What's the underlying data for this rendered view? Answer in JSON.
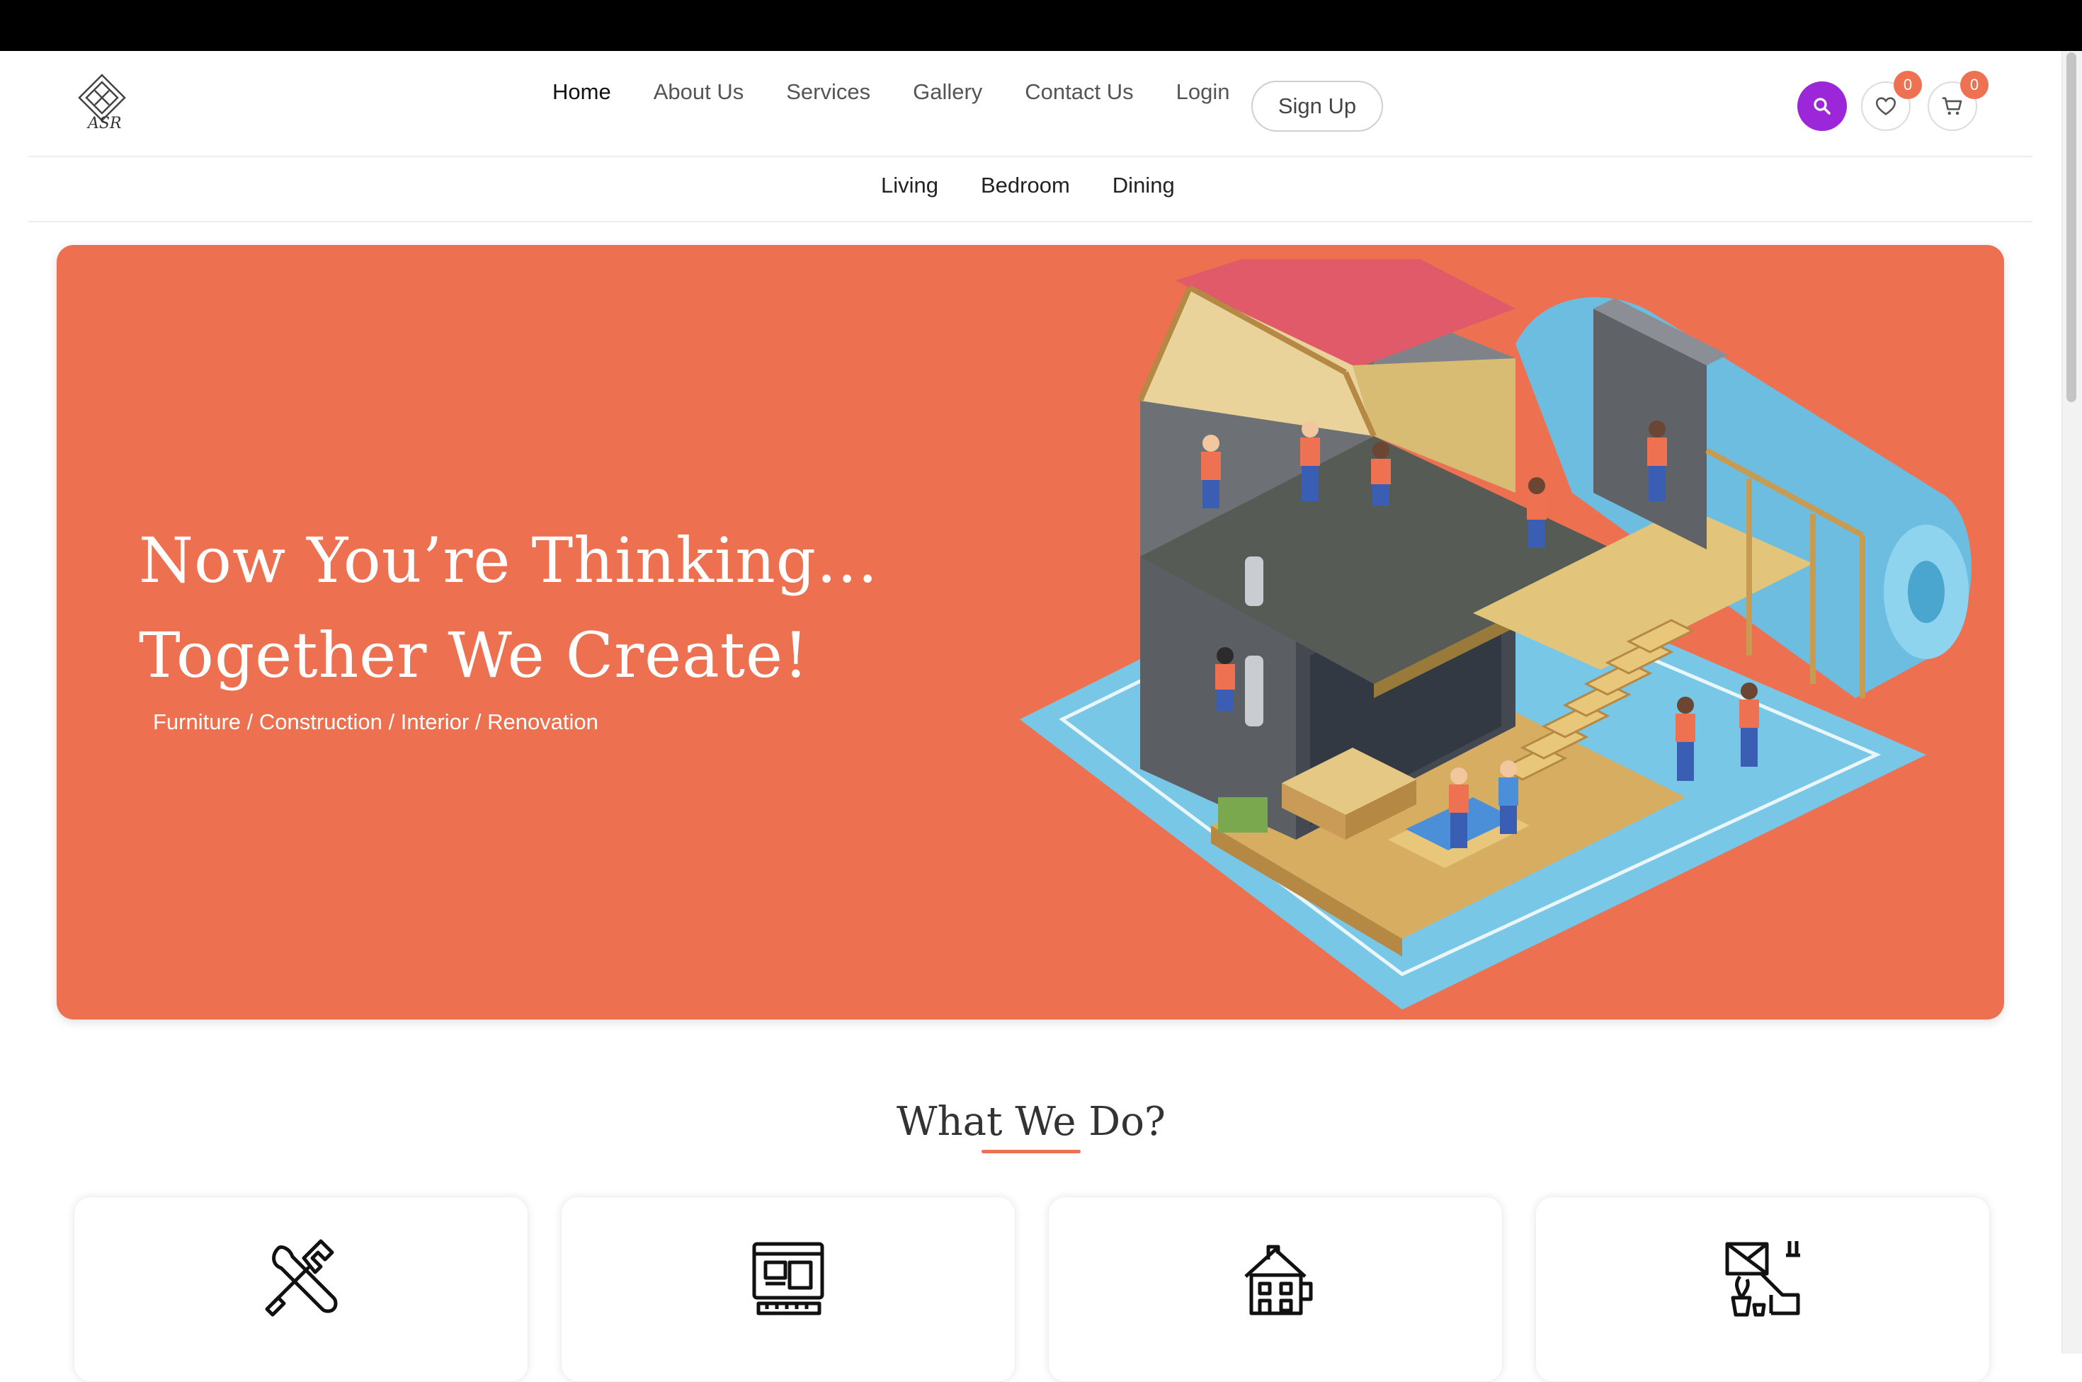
{
  "brand": {
    "logo_text": "ASR"
  },
  "nav": {
    "items": [
      {
        "label": "Home",
        "active": true
      },
      {
        "label": "About Us",
        "active": false
      },
      {
        "label": "Services",
        "active": false
      },
      {
        "label": "Gallery",
        "active": false
      },
      {
        "label": "Contact Us",
        "active": false
      },
      {
        "label": "Login",
        "active": false
      }
    ],
    "signup_label": "Sign Up"
  },
  "actions": {
    "search_icon": "search-icon",
    "wishlist_count": "0",
    "cart_count": "0",
    "search_color": "#9b27d9",
    "badge_color": "#ee7152"
  },
  "subnav": {
    "items": [
      "Living",
      "Bedroom",
      "Dining"
    ]
  },
  "hero": {
    "line1": "Now You’re Thinking...",
    "line2": "Together We Create!",
    "tagline": "Furniture / Construction / Interior / Renovation",
    "background": "#ed7151"
  },
  "services": {
    "title": "What We Do?",
    "cards": [
      {
        "icon": "tools-icon"
      },
      {
        "icon": "blueprint-icon"
      },
      {
        "icon": "house-building-icon"
      },
      {
        "icon": "interior-design-icon"
      }
    ]
  }
}
